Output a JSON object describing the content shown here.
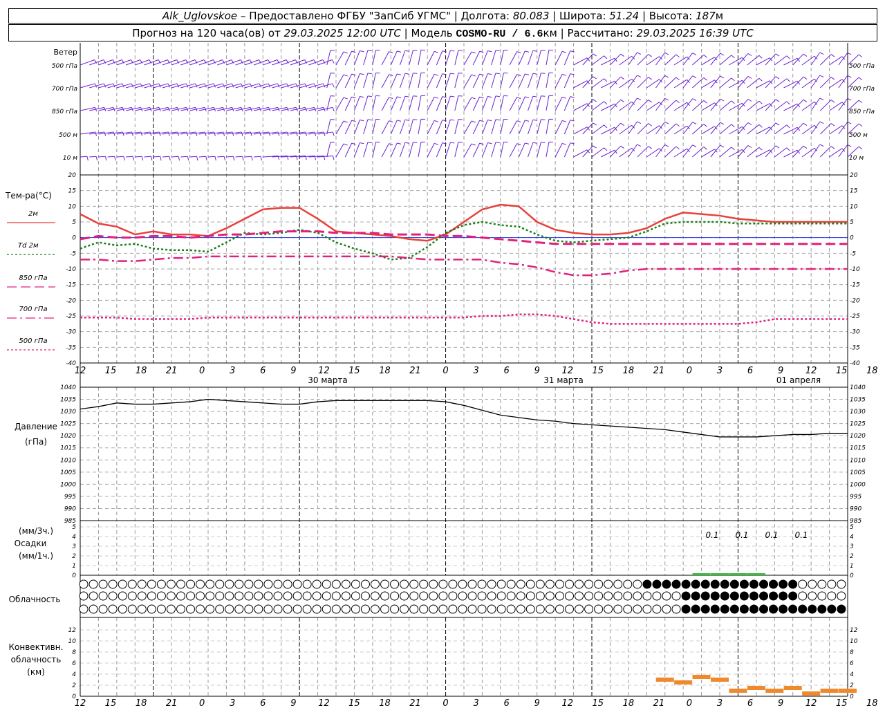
{
  "header": {
    "station": "Alk_Uglovskoe",
    "provider": "– Предоставлено ФГБУ \"ЗапСиб УГМС\"",
    "lon_label": "Долгота:",
    "lon_value": "80.083",
    "lat_label": "Широта:",
    "lat_value": "51.24",
    "alt_label": "Высота:",
    "alt_value": "187",
    "alt_unit": "м",
    "forecast_prefix": "Прогноз на 120 часа(ов) от",
    "forecast_time": "29.03.2025 12:00 UTC",
    "model_label": "Модель",
    "model_name": "COSMO-RU / 6.6",
    "model_unit": "км",
    "computed_label": "Рассчитано:",
    "computed_time": "29.03.2025 16:39 UTC"
  },
  "wind_panel": {
    "title": "Ветер",
    "levels": [
      "500 гПа",
      "700 гПа",
      "850 гПа",
      "500 м",
      "10 м"
    ]
  },
  "temp_panel": {
    "title": "Тем-ра(°C)",
    "legend": [
      {
        "label": "2м",
        "color": "#e8403a",
        "style": "solid"
      },
      {
        "label": "Td 2м",
        "color": "#1a7f1a",
        "style": "dotted"
      },
      {
        "label": "850 гПа",
        "color": "#e0207f",
        "style": "dashed"
      },
      {
        "label": "700 гПа",
        "color": "#e0207f",
        "style": "dashdot"
      },
      {
        "label": "500 гПа",
        "color": "#e0207f",
        "style": "dotted"
      }
    ],
    "ticks": [
      20,
      15,
      10,
      5,
      0,
      -5,
      -10,
      -15,
      -20,
      -25,
      -30,
      -35,
      -40
    ]
  },
  "time_axis": {
    "hours": [
      "12",
      "15",
      "18",
      "21",
      "0",
      "3",
      "6",
      "9",
      "12",
      "15",
      "18",
      "21",
      "0",
      "3",
      "6",
      "9",
      "12",
      "15",
      "18",
      "21",
      "0",
      "3",
      "6",
      "9",
      "12",
      "15",
      "18"
    ],
    "dates": [
      "30 марта",
      "31 марта",
      "01 апреля"
    ]
  },
  "pressure_panel": {
    "title_1": "Давление",
    "title_2": "(гПа)",
    "ticks": [
      1040,
      1035,
      1030,
      1025,
      1020,
      1015,
      1010,
      1005,
      1000,
      995,
      990,
      985
    ]
  },
  "precip_panel": {
    "title_1": "(мм/3ч.)",
    "title_2": "Осадки",
    "title_3": "(мм/1ч.)",
    "ticks": [
      5,
      4,
      3,
      2,
      1,
      0
    ],
    "labels": [
      "0.1",
      "0.1",
      "0.1",
      "0.1"
    ]
  },
  "cloud_panel": {
    "title": "Облачность"
  },
  "conv_panel": {
    "title_1": "Конвективн.",
    "title_2": "облачность",
    "title_3": "(км)",
    "ticks": [
      12,
      10,
      8,
      6,
      4,
      2,
      0
    ]
  },
  "chart_data": [
    {
      "type": "line",
      "title": "Тем-ра(°C)",
      "x_hours": [
        0,
        3,
        6,
        9,
        12,
        15,
        18,
        21,
        24,
        27,
        30,
        33,
        36,
        39,
        42,
        45,
        48,
        51,
        54,
        57,
        60,
        63,
        66,
        69,
        72,
        75,
        78,
        81,
        84,
        87,
        90,
        93,
        96,
        99,
        102,
        105,
        108,
        111,
        114,
        117,
        120,
        123,
        126
      ],
      "ylim": [
        -40,
        20
      ],
      "series": [
        {
          "name": "2м",
          "color": "#e8403a",
          "values": [
            7.5,
            4.5,
            3.5,
            1,
            2,
            1,
            1,
            0.5,
            3,
            6,
            9,
            9.5,
            9.5,
            6,
            2,
            1.5,
            1,
            0.5,
            -0.5,
            -1,
            1,
            5,
            9,
            10.5,
            10,
            5,
            2.5,
            1.5,
            1,
            1,
            1.5,
            3,
            6,
            8,
            7.5,
            7,
            6,
            5.5,
            5,
            5,
            5,
            5,
            5
          ]
        },
        {
          "name": "Td 2м",
          "color": "#1a7f1a",
          "values": [
            -3.5,
            -1.5,
            -2.5,
            -2,
            -3.5,
            -4,
            -4,
            -4.5,
            -1.5,
            1.5,
            1,
            1.5,
            2.5,
            1.5,
            -1.5,
            -3.5,
            -5,
            -7,
            -6.5,
            -3,
            1.5,
            4,
            5,
            4,
            3.5,
            1,
            -1,
            -1.5,
            -1,
            -0.5,
            0,
            2,
            4.5,
            5,
            5,
            5,
            4.5,
            4.5,
            4.5,
            4.5,
            4.5,
            4.5,
            4.5
          ]
        },
        {
          "name": "850 гПа",
          "color": "#e0207f",
          "values": [
            -0.5,
            0.5,
            0,
            0,
            0.5,
            0.5,
            0,
            0.5,
            1,
            1,
            1.5,
            2,
            2,
            2,
            1.5,
            1.5,
            1.5,
            1,
            1,
            1,
            0.5,
            0.5,
            0,
            -0.5,
            -1,
            -1.5,
            -2,
            -2,
            -2,
            -2,
            -2,
            -2,
            -2,
            -2,
            -2,
            -2,
            -2,
            -2,
            -2,
            -2,
            -2,
            -2,
            -2
          ]
        },
        {
          "name": "700 гПа",
          "color": "#e0207f",
          "values": [
            -7,
            -7,
            -7.5,
            -7.5,
            -7,
            -6.5,
            -6.5,
            -6,
            -6,
            -6,
            -6,
            -6,
            -6,
            -6,
            -6,
            -6,
            -6,
            -6,
            -6.5,
            -7,
            -7,
            -7,
            -7,
            -8,
            -8.5,
            -9.5,
            -11,
            -12,
            -12,
            -11.5,
            -10.5,
            -10,
            -10,
            -10,
            -10,
            -10,
            -10,
            -10,
            -10,
            -10,
            -10,
            -10,
            -10
          ]
        },
        {
          "name": "500 гПа",
          "color": "#e0207f",
          "values": [
            -25.5,
            -25.5,
            -25.5,
            -26,
            -26,
            -26,
            -26,
            -25.5,
            -25.5,
            -25.5,
            -25.5,
            -25.5,
            -25.5,
            -25.5,
            -25.5,
            -25.5,
            -25.5,
            -25.5,
            -25.5,
            -25.5,
            -25.5,
            -25.5,
            -25,
            -25,
            -24.5,
            -24.5,
            -25,
            -26,
            -27,
            -27.5,
            -27.5,
            -27.5,
            -27.5,
            -27.5,
            -27.5,
            -27.5,
            -27.5,
            -27,
            -26,
            -26,
            -26,
            -26,
            -26
          ]
        }
      ]
    },
    {
      "type": "line",
      "title": "Давление",
      "x_hours": [
        0,
        3,
        6,
        9,
        12,
        15,
        18,
        21,
        24,
        27,
        30,
        33,
        36,
        39,
        42,
        45,
        48,
        51,
        54,
        57,
        60,
        63,
        66,
        69,
        72,
        75,
        78,
        81,
        84,
        87,
        90,
        93,
        96,
        99,
        102,
        105,
        108,
        111,
        114,
        117,
        120,
        123,
        126
      ],
      "ylim": [
        985,
        1040
      ],
      "series": [
        {
          "name": "Давление",
          "color": "#000000",
          "values": [
            1031,
            1032,
            1033.5,
            1033,
            1033,
            1033.5,
            1034,
            1035,
            1034.5,
            1034,
            1033.5,
            1033,
            1033,
            1034,
            1034.5,
            1034.5,
            1034.5,
            1034.5,
            1034.5,
            1034.5,
            1034,
            1032.5,
            1030.5,
            1028.5,
            1027.5,
            1026.5,
            1026,
            1025,
            1024.5,
            1024,
            1023.5,
            1023,
            1022.5,
            1021.5,
            1020.5,
            1019.5,
            1019.5,
            1019.5,
            1020,
            1020.5,
            1020.5,
            1021,
            1021
          ]
        }
      ]
    },
    {
      "type": "bar",
      "title": "Осадки",
      "x_hours": [
        102,
        105,
        108,
        111,
        114,
        117
      ],
      "values": [
        0.1,
        0.1,
        0.1,
        0.1,
        0,
        0
      ],
      "ylim": [
        0,
        5
      ]
    },
    {
      "type": "bar",
      "title": "Конвективн. облачность",
      "x_hours": [
        96,
        99,
        102,
        105,
        108,
        111,
        114,
        117,
        120,
        123,
        126
      ],
      "values": [
        3,
        2.5,
        3.5,
        3,
        1,
        1.5,
        1,
        1.5,
        0.5,
        1,
        1
      ],
      "ylim": [
        0,
        13
      ]
    }
  ]
}
